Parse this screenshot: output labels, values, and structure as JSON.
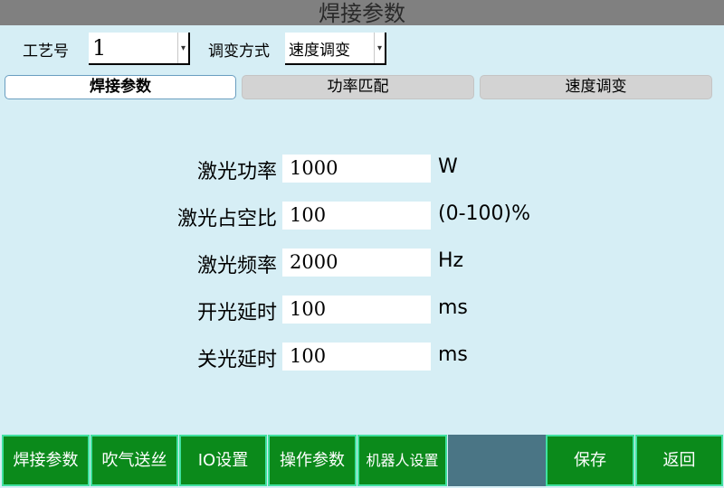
{
  "title": "焊接参数",
  "header": {
    "process_label": "工艺号",
    "process_value": "1",
    "adjust_label": "调变方式",
    "adjust_value": "速度调变"
  },
  "tabs": [
    {
      "label": "焊接参数",
      "active": true
    },
    {
      "label": "功率匹配",
      "active": false
    },
    {
      "label": "速度调变",
      "active": false
    }
  ],
  "params": [
    {
      "label": "激光功率",
      "value": "1000",
      "unit": "W"
    },
    {
      "label": "激光占空比",
      "value": "100",
      "unit": "(0-100)%"
    },
    {
      "label": "激光频率",
      "value": "2000",
      "unit": "Hz"
    },
    {
      "label": "开光延时",
      "value": "100",
      "unit": "ms"
    },
    {
      "label": "关光延时",
      "value": "100",
      "unit": "ms"
    }
  ],
  "bottom_nav": {
    "weld_params": "焊接参数",
    "gas_wire": "吹气送丝",
    "io_settings": "IO设置",
    "operation_params": "操作参数",
    "robot_settings": "机器人设置",
    "save": "保存",
    "back": "返回"
  },
  "colors": {
    "background": "#d6eef5",
    "titlebar": "#808080",
    "nav_button": "#0b8a1b",
    "nav_border": "#40e0a0",
    "spacer": "#4a7585"
  }
}
